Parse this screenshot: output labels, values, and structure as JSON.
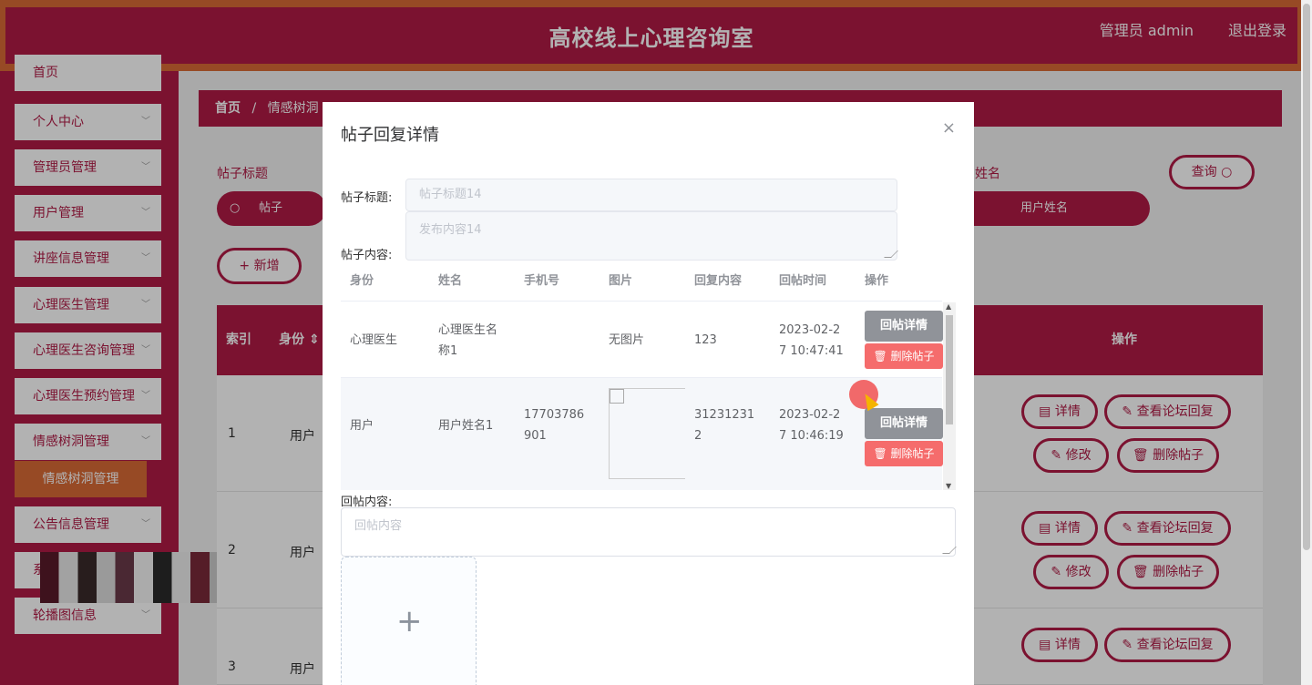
{
  "header": {
    "title": "高校线上心理咨询室",
    "user": "管理员 admin",
    "logout": "退出登录"
  },
  "sidebar": {
    "items": [
      {
        "label": "首页"
      },
      {
        "label": "个人中心"
      },
      {
        "label": "管理员管理"
      },
      {
        "label": "用户管理"
      },
      {
        "label": "讲座信息管理"
      },
      {
        "label": "心理医生管理"
      },
      {
        "label": "心理医生咨询管理"
      },
      {
        "label": "心理医生预约管理"
      },
      {
        "label": "情感树洞管理"
      },
      {
        "label": "公告信息管理"
      },
      {
        "label": "系"
      },
      {
        "label": "轮播图信息"
      }
    ],
    "active_sub": "情感树洞管理"
  },
  "breadcrumb": {
    "home": "首页",
    "sep": "/",
    "current": "情感树洞"
  },
  "search": {
    "title_label": "帖子标题",
    "name_label_partial": "姓名",
    "title_placeholder_partial": "帖子",
    "name_placeholder": "用户姓名",
    "query_button": "查询 ○",
    "add_button": "+ 新增"
  },
  "main_table": {
    "headers": [
      "索引",
      "身份 ⇕",
      "操作"
    ],
    "rows": [
      {
        "index": "1",
        "identity": "用户"
      },
      {
        "index": "2",
        "identity": "用户"
      },
      {
        "index": "3",
        "identity": "用户"
      }
    ],
    "buttons": {
      "detail": "▤ 详情",
      "view_reply": "✎ 查看论坛回复",
      "edit": "✎ 修改",
      "delete": "🗑 删除帖子"
    }
  },
  "dialog": {
    "title": "帖子回复详情",
    "close": "×",
    "title_label": "帖子标题:",
    "title_value": "帖子标题14",
    "content_label": "帖子内容:",
    "content_value": "发布内容14",
    "reply_headers": [
      "身份",
      "姓名",
      "手机号",
      "图片",
      "回复内容",
      "回帖时间",
      "操作"
    ],
    "replies": [
      {
        "identity": "心理医生",
        "name_line1": "心理医生名",
        "name_line2": "称1",
        "phone_line1": "",
        "phone_line2": "",
        "image": "无图片",
        "content_line1": "123",
        "content_line2": "",
        "time_line1": "2023-02-2",
        "time_line2": "7 10:47:41"
      },
      {
        "identity": "用户",
        "name_line1": "用户姓名1",
        "name_line2": "",
        "phone_line1": "17703786",
        "phone_line2": "901",
        "image": "",
        "content_line1": "31231231",
        "content_line2": "2",
        "time_line1": "2023-02-2",
        "time_line2": "7 10:46:19"
      }
    ],
    "reply_detail_btn": "回帖详情",
    "delete_reply_btn": "🗑 删除帖子",
    "reply_content_label": "回帖内容:",
    "reply_content_placeholder": "回帖内容",
    "upload_plus": "+"
  }
}
